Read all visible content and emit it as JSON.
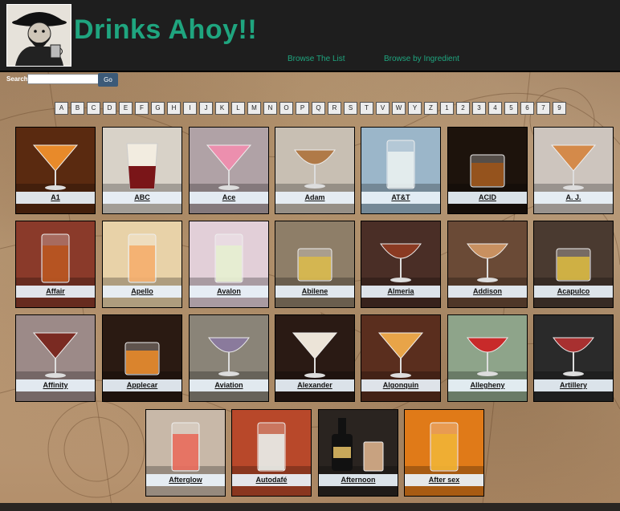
{
  "site": {
    "title": "Drinks Ahoy!!"
  },
  "nav": {
    "browse_list": "Browse The List",
    "browse_ingredient": "Browse by Ingredient"
  },
  "search": {
    "label": "Search:",
    "value": "",
    "placeholder": "",
    "button": "Go"
  },
  "alphabet": [
    "A",
    "B",
    "C",
    "D",
    "E",
    "F",
    "G",
    "H",
    "I",
    "J",
    "K",
    "L",
    "M",
    "N",
    "O",
    "P",
    "Q",
    "R",
    "S",
    "T",
    "V",
    "W",
    "Y",
    "Z",
    "1",
    "2",
    "3",
    "4",
    "5",
    "6",
    "7",
    "9"
  ],
  "drinks": [
    {
      "name": "A1",
      "glass": "martini",
      "liquid": "#e88a2a",
      "bg": "#5a2a10"
    },
    {
      "name": "ABC",
      "glass": "shot",
      "liquid": "#7a1518",
      "bg": "#d8d2c8"
    },
    {
      "name": "Ace",
      "glass": "martini",
      "liquid": "#ec8fae",
      "bg": "#b0a2a6"
    },
    {
      "name": "Adam",
      "glass": "coupe",
      "liquid": "#b07a48",
      "bg": "#c8bfb3"
    },
    {
      "name": "AT&T",
      "glass": "tall",
      "liquid": "#e8f0f0",
      "bg": "#9bb6c9"
    },
    {
      "name": "ACID",
      "glass": "rocks",
      "liquid": "#9c5418",
      "bg": "#1d130c"
    },
    {
      "name": "A. J.",
      "glass": "martini",
      "liquid": "#d48a4a",
      "bg": "#cdc5be"
    },
    {
      "name": "Affair",
      "glass": "tall",
      "liquid": "#b8521c",
      "bg": "#8a3a2a"
    },
    {
      "name": "Apello",
      "glass": "tall",
      "liquid": "#f4ad6a",
      "bg": "#e8d2a8"
    },
    {
      "name": "Avalon",
      "glass": "tall",
      "liquid": "#e6eed0",
      "bg": "#e2cfd8"
    },
    {
      "name": "Abilene",
      "glass": "rocks",
      "liquid": "#d8b84a",
      "bg": "#8e7e68"
    },
    {
      "name": "Almeria",
      "glass": "coupe",
      "liquid": "#8a3a22",
      "bg": "#4a2e26"
    },
    {
      "name": "Addison",
      "glass": "coupe",
      "liquid": "#c89060",
      "bg": "#6a4a36"
    },
    {
      "name": "Acapulco",
      "glass": "rocks",
      "liquid": "#d8b840",
      "bg": "#4a3a30"
    },
    {
      "name": "Affinity",
      "glass": "martini",
      "liquid": "#7a2a22",
      "bg": "#9c8a88"
    },
    {
      "name": "Applecar",
      "glass": "rocks",
      "liquid": "#e88a2a",
      "bg": "#2a1a12"
    },
    {
      "name": "Aviation",
      "glass": "coupe",
      "liquid": "#8a7a9c",
      "bg": "#8a8478"
    },
    {
      "name": "Alexander",
      "glass": "martini",
      "liquid": "#ece4d8",
      "bg": "#2a1a14"
    },
    {
      "name": "Algonquin",
      "glass": "martini",
      "liquid": "#e8a448",
      "bg": "#5a2e1e"
    },
    {
      "name": "Allegheny",
      "glass": "coupe",
      "liquid": "#c82a2a",
      "bg": "#8ea48a"
    },
    {
      "name": "Artillery",
      "glass": "coupe",
      "liquid": "#a83030",
      "bg": "#2a2a2a"
    },
    {
      "name": "Afterglow",
      "glass": "tall",
      "liquid": "#e86a5a",
      "bg": "#c8b8a8"
    },
    {
      "name": "Autodafé",
      "glass": "tall",
      "liquid": "#e8ece8",
      "bg": "#b8482a"
    },
    {
      "name": "Afternoon",
      "glass": "bottle",
      "liquid": "#c8a280",
      "bg": "#2a2420"
    },
    {
      "name": "After sex",
      "glass": "tall",
      "liquid": "#f0b030",
      "bg": "#e07a18"
    }
  ]
}
